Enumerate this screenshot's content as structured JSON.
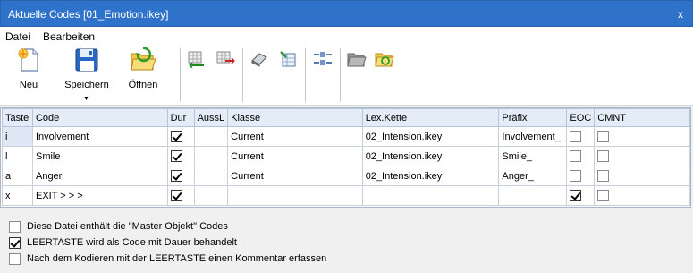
{
  "window": {
    "title": "Aktuelle Codes [01_Emotion.ikey]",
    "close_glyph": "x"
  },
  "menu": [
    "Datei",
    "Bearbeiten"
  ],
  "toolbar": {
    "new_label": "Neu",
    "save_label": "Speichern",
    "open_label": "Öffnen",
    "icons": [
      "new-doc-icon",
      "floppy-disk-icon",
      "folder-open-icon",
      "insert-column-icon",
      "delete-column-icon",
      "eraser-icon",
      "grid-edit-icon",
      "split-column-icon",
      "merge-column-icon",
      "folder-icon",
      "folder-link-icon"
    ]
  },
  "grid": {
    "columns": [
      "Taste",
      "Code",
      "Dur",
      "AussL",
      "Klasse",
      "Lex.Kette",
      "Präfix",
      "EOC",
      "CMNT"
    ],
    "rows": [
      {
        "taste": "i",
        "code": "Involvement",
        "dur": true,
        "aussl": "",
        "klasse": "Current",
        "lex": "02_Intension.ikey",
        "praefix": "Involvement_",
        "eoc": false,
        "cmnt": false
      },
      {
        "taste": "l",
        "code": "Smile",
        "dur": true,
        "aussl": "",
        "klasse": "Current",
        "lex": "02_Intension.ikey",
        "praefix": "Smile_",
        "eoc": false,
        "cmnt": false
      },
      {
        "taste": "a",
        "code": "Anger",
        "dur": true,
        "aussl": "",
        "klasse": "Current",
        "lex": "02_Intension.ikey",
        "praefix": "Anger_",
        "eoc": false,
        "cmnt": false
      },
      {
        "taste": "x",
        "code": "EXIT > > >",
        "dur": true,
        "aussl": "",
        "klasse": "",
        "lex": "",
        "praefix": "",
        "eoc": true,
        "cmnt": false
      }
    ]
  },
  "options": [
    {
      "label": "Diese Datei enthält die \"Master Objekt\" Codes",
      "checked": false
    },
    {
      "label": "LEERTASTE wird als Code mit Dauer behandelt",
      "checked": true
    },
    {
      "label": "Nach dem Kodieren mit der LEERTASTE einen Kommentar erfassen",
      "checked": false
    }
  ],
  "colors": {
    "titlebar": "#2f72c9",
    "header": "#e4ecf7"
  }
}
